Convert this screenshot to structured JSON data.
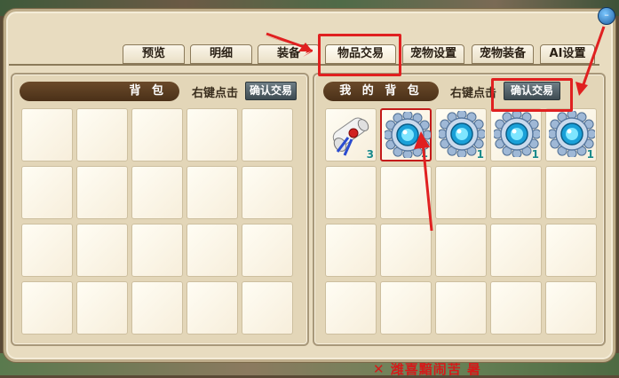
{
  "background_text": "✕ 潍喜黯闹苦 暑",
  "tabs": [
    {
      "label": "预览",
      "active": false
    },
    {
      "label": "明细",
      "active": false
    },
    {
      "label": "装备",
      "active": false
    },
    {
      "label": "物品交易",
      "active": true
    },
    {
      "label": "宠物设置",
      "active": false
    },
    {
      "label": "宠物装备",
      "active": false
    },
    {
      "label": "AI设置",
      "active": false
    }
  ],
  "left_panel": {
    "header": "背 包",
    "hint": "右键点击",
    "confirm_label": "确认交易",
    "slots": []
  },
  "right_panel": {
    "header": "我 的 背 包",
    "hint": "右键点击",
    "confirm_label": "确认交易",
    "items": [
      {
        "icon": "scroll-icon",
        "qty": "3"
      },
      {
        "icon": "blue-gem-icon",
        "qty": "1",
        "selected": true
      },
      {
        "icon": "blue-gem-icon",
        "qty": "1"
      },
      {
        "icon": "blue-gem-icon",
        "qty": "1"
      },
      {
        "icon": "blue-gem-icon",
        "qty": "1"
      }
    ]
  },
  "colors": {
    "highlight": "#e02020",
    "header": "#4a3018",
    "button": "#3e4b52"
  }
}
